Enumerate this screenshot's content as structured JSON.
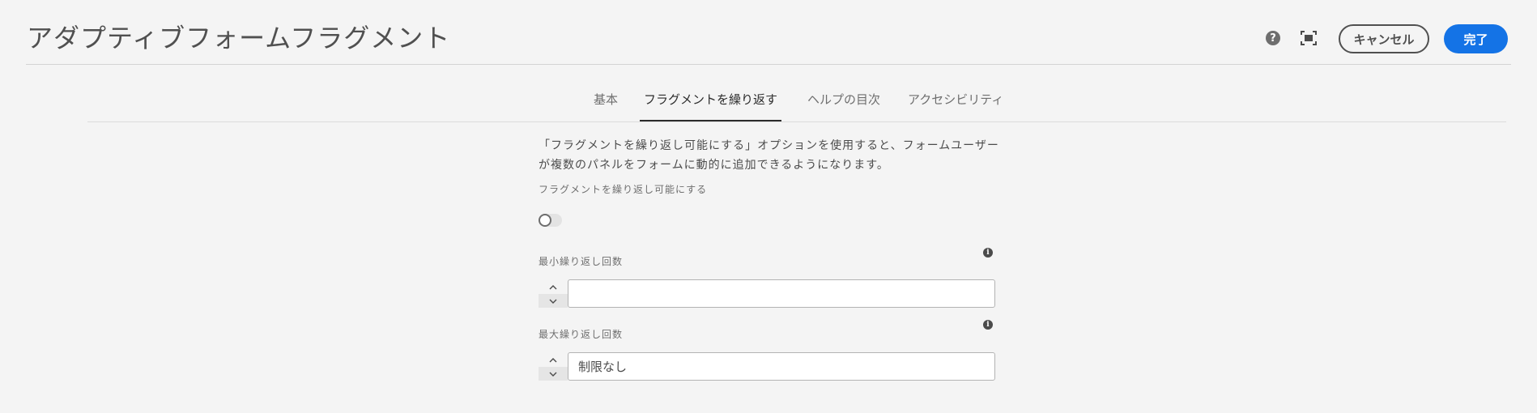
{
  "header": {
    "title": "アダプティブフォームフラグメント",
    "cancel_label": "キャンセル",
    "done_label": "完了",
    "help_glyph": "?"
  },
  "tabs": [
    {
      "label": "基本",
      "active": false
    },
    {
      "label": "フラグメントを繰り返す",
      "active": true
    },
    {
      "label": "ヘルプの目次",
      "active": false
    },
    {
      "label": "アクセシビリティ",
      "active": false
    }
  ],
  "panel": {
    "description": "「フラグメントを繰り返し可能にする」オプションを使用すると、フォームユーザーが複数のパネルをフォームに動的に追加できるようになります。",
    "repeat_toggle_label": "フラグメントを繰り返し可能にする",
    "repeat_toggle_on": false,
    "min": {
      "label": "最小繰り返し回数",
      "value": "",
      "placeholder": ""
    },
    "max": {
      "label": "最大繰り返し回数",
      "value": "",
      "placeholder": "制限なし"
    },
    "info_glyph": "i"
  }
}
